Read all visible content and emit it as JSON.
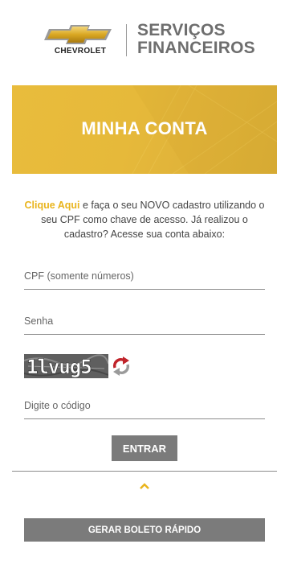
{
  "header": {
    "logo_word": "CHEVROLET",
    "brand_line1": "SERVIÇOS",
    "brand_line2": "FINANCEIROS"
  },
  "banner": {
    "title": "MINHA CONTA"
  },
  "intro": {
    "link_text": "Clique Aqui",
    "text": " e faça o seu NOVO cadastro utilizando o seu CPF como chave de acesso. Já realizou o cadastro? Acesse sua conta abaixo:"
  },
  "form": {
    "cpf_placeholder": "CPF (somente números)",
    "password_placeholder": "Senha",
    "captcha_text": "1lvug5",
    "code_placeholder": "Digite o código",
    "submit_label": "ENTRAR"
  },
  "footer": {
    "boleto_label": "GERAR BOLETO RÁPIDO"
  },
  "icons": {
    "logo": "chevrolet-bowtie-icon",
    "refresh": "refresh-icon",
    "chevron": "chevron-up-icon"
  },
  "colors": {
    "accent": "#e9b41c",
    "banner": "#e6b93a",
    "button": "#7b7b7b",
    "brand_gray": "#6e6e6e"
  }
}
